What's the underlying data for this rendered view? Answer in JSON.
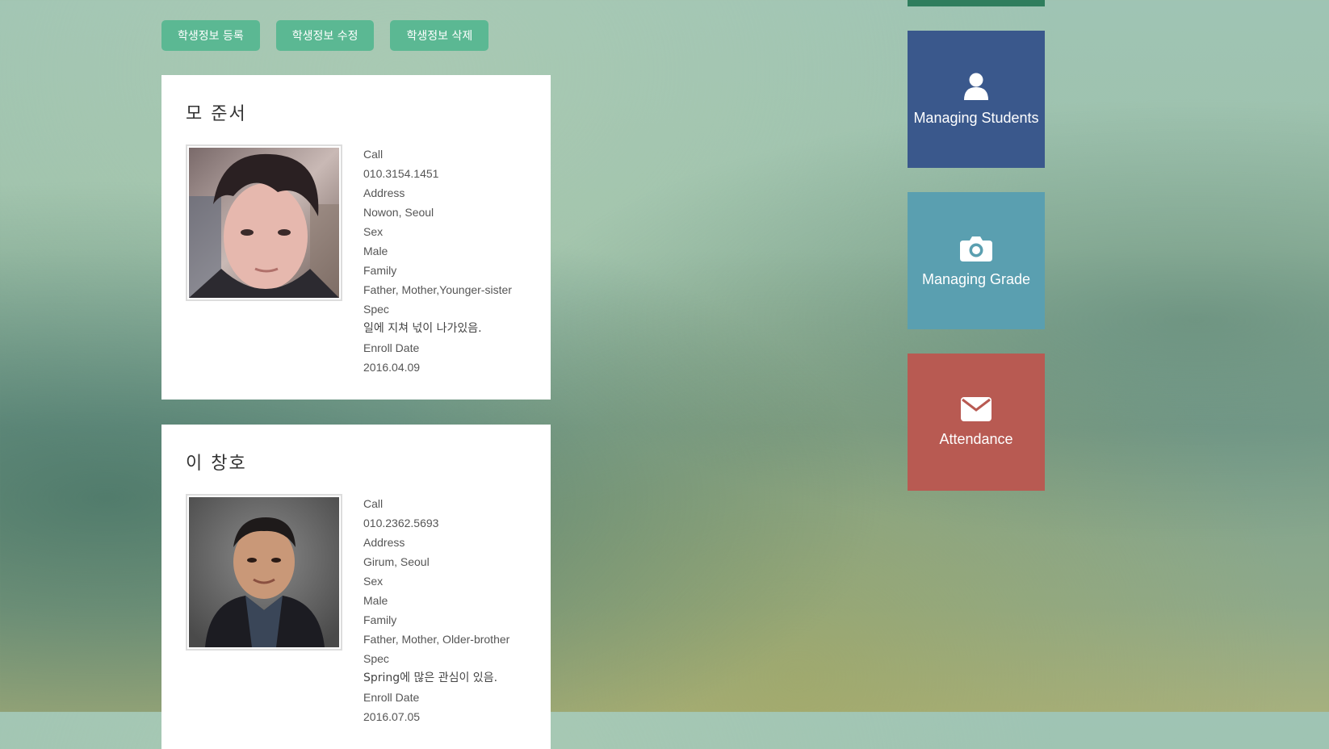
{
  "toolbar": {
    "register_label": "학생정보 등록",
    "edit_label": "학생정보 수정",
    "delete_label": "학생정보 삭제"
  },
  "students": [
    {
      "name": "모 준서",
      "call_label": "Call",
      "call": "010.3154.1451",
      "address_label": "Address",
      "address": "Nowon, Seoul",
      "sex_label": "Sex",
      "sex": "Male",
      "family_label": "Family",
      "family": "Father, Mother,Younger-sister",
      "spec_label": "Spec",
      "spec": "일에 지쳐 넋이 나가있음.",
      "enroll_label": "Enroll Date",
      "enroll": "2016.04.09"
    },
    {
      "name": "이 창호",
      "call_label": "Call",
      "call": "010.2362.5693",
      "address_label": "Address",
      "address": "Girum, Seoul",
      "sex_label": "Sex",
      "sex": "Male",
      "family_label": "Family",
      "family": "Father, Mother, Older-brother",
      "spec_label": "Spec",
      "spec": "Spring에 많은 관심이 있음.",
      "enroll_label": "Enroll Date",
      "enroll": "2016.07.05"
    }
  ],
  "tiles": [
    {
      "label": "Managing Students",
      "icon": "user-icon",
      "color": "#3a588c"
    },
    {
      "label": "Managing Grade",
      "icon": "camera-icon",
      "color": "#5a9fb0"
    },
    {
      "label": "Attendance",
      "icon": "envelope-icon",
      "color": "#b85a52"
    }
  ],
  "colors": {
    "button": "#5bb893",
    "top_strip": "#2f7d5d"
  }
}
